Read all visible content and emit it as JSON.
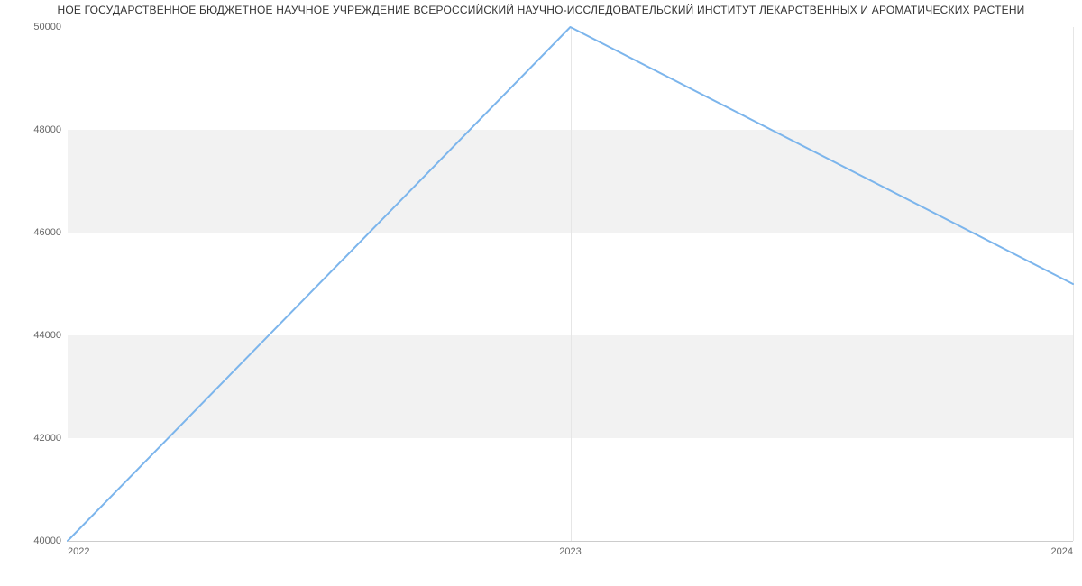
{
  "chart_data": {
    "type": "line",
    "title": "НОЕ ГОСУДАРСТВЕННОЕ БЮДЖЕТНОЕ НАУЧНОЕ УЧРЕЖДЕНИЕ ВСЕРОССИЙСКИЙ НАУЧНО-ИССЛЕДОВАТЕЛЬСКИЙ ИНСТИТУТ ЛЕКАРСТВЕННЫХ И АРОМАТИЧЕСКИХ РАСТЕНИ",
    "categories": [
      "2022",
      "2023",
      "2024"
    ],
    "values": [
      40000,
      50000,
      45000
    ],
    "ylim": [
      40000,
      50000
    ],
    "y_ticks": [
      40000,
      42000,
      44000,
      46000,
      48000,
      50000
    ],
    "y_bands": [
      [
        42000,
        44000
      ],
      [
        46000,
        48000
      ]
    ],
    "xlabel": "",
    "ylabel": "",
    "colors": {
      "series": "#7cb5ec",
      "band": "#f2f2f2",
      "axis": "#cccccc"
    }
  }
}
